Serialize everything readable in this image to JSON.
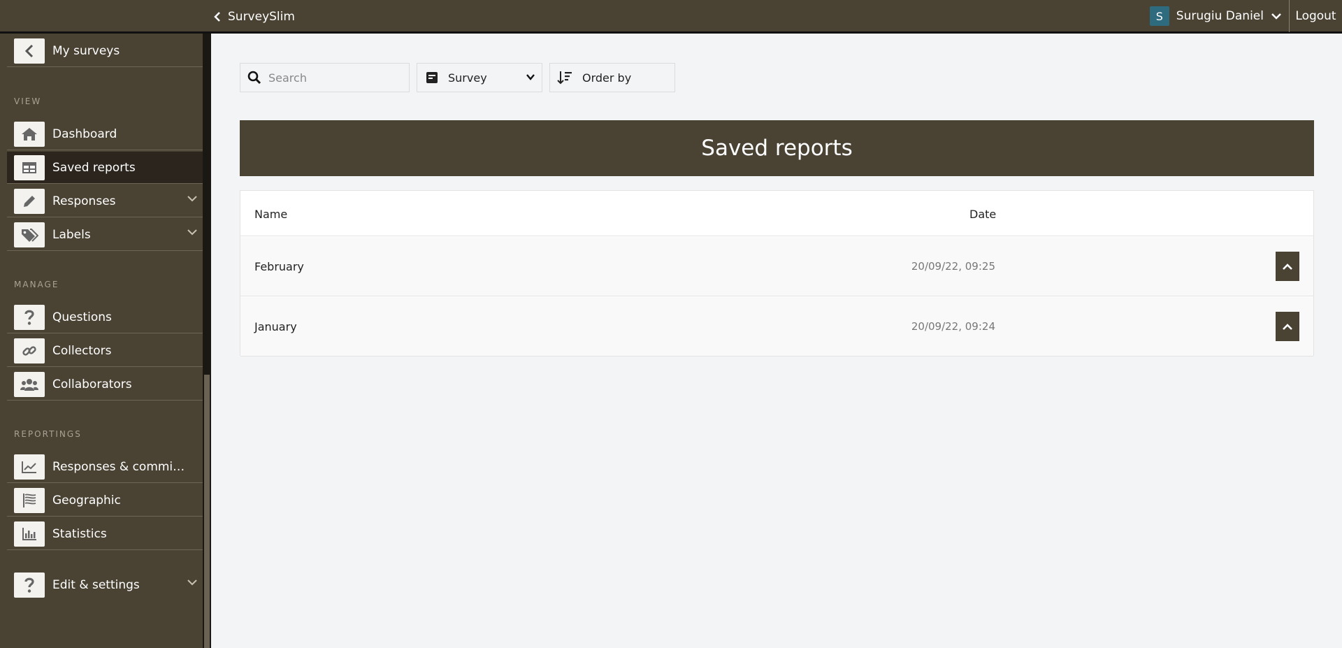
{
  "topbar": {
    "brand": "SurveySlim",
    "user_initial": "S",
    "user_name": "Surugiu Daniel",
    "logout": "Logout"
  },
  "sidebar": {
    "back_label": "My surveys",
    "sections": {
      "view": "VIEW",
      "manage": "MANAGE",
      "reportings": "REPORTINGS"
    },
    "items": {
      "dashboard": "Dashboard",
      "saved_reports": "Saved reports",
      "responses": "Responses",
      "labels": "Labels",
      "questions": "Questions",
      "collectors": "Collectors",
      "collaborators": "Collaborators",
      "responses_commission": "Responses & commissio...",
      "geographic": "Geographic",
      "statistics": "Statistics",
      "edit_settings": "Edit & settings"
    }
  },
  "toolbar": {
    "search_placeholder": "Search",
    "survey_select": "Survey",
    "order_by": "Order by"
  },
  "reports": {
    "title": "Saved reports",
    "columns": {
      "name": "Name",
      "date": "Date"
    },
    "rows": [
      {
        "name": "February",
        "date": "20/09/22, 09:25"
      },
      {
        "name": "January",
        "date": "20/09/22, 09:24"
      }
    ]
  },
  "colors": {
    "primary": "#4a4233",
    "active": "#2b251d",
    "avatar": "#2f6b7f"
  }
}
